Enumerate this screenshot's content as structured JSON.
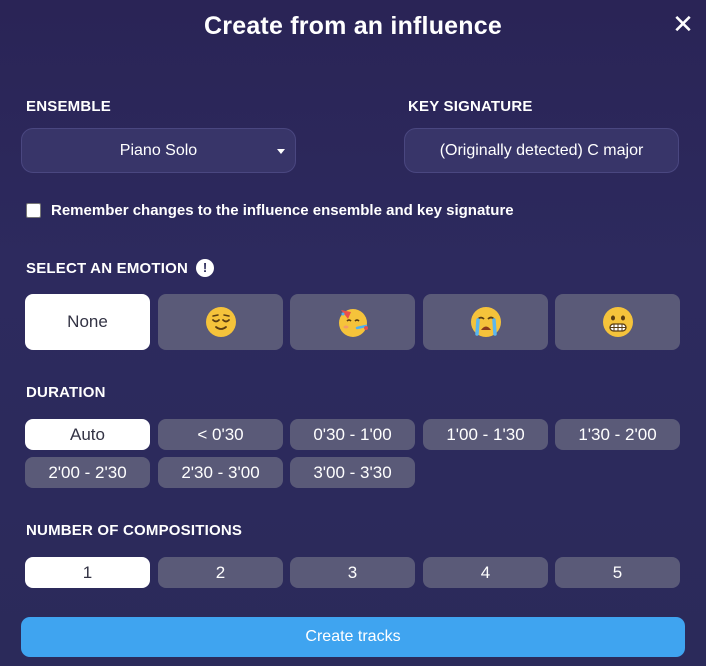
{
  "header": {
    "title": "Create from an influence",
    "close_glyph": "✕"
  },
  "ensemble": {
    "label": "ENSEMBLE",
    "value": "Piano Solo"
  },
  "key_signature": {
    "label": "KEY SIGNATURE",
    "value": "(Originally detected) C major"
  },
  "remember": {
    "label": "Remember changes to the influence ensemble and key signature",
    "checked": false
  },
  "emotion": {
    "label": "SELECT AN EMOTION",
    "info_glyph": "!",
    "none_label": "None",
    "options": [
      {
        "icon": "relieved-face-icon"
      },
      {
        "icon": "party-face-icon"
      },
      {
        "icon": "crying-face-icon"
      },
      {
        "icon": "grimacing-face-icon"
      }
    ],
    "selected": "None"
  },
  "duration": {
    "label": "DURATION",
    "options": [
      "Auto",
      "< 0'30",
      "0'30 - 1'00",
      "1'00 - 1'30",
      "1'30 - 2'00",
      "2'00 - 2'30",
      "2'30 - 3'00",
      "3'00 - 3'30"
    ],
    "selected": "Auto"
  },
  "compositions": {
    "label": "NUMBER OF COMPOSITIONS",
    "options": [
      "1",
      "2",
      "3",
      "4",
      "5"
    ],
    "selected": "1"
  },
  "cta": {
    "label": "Create tracks"
  },
  "colors": {
    "accent": "#3fa4f0",
    "option_bg": "#5a5a78",
    "selected_bg": "#ffffff",
    "emoji_yellow": "#f5c33b"
  }
}
